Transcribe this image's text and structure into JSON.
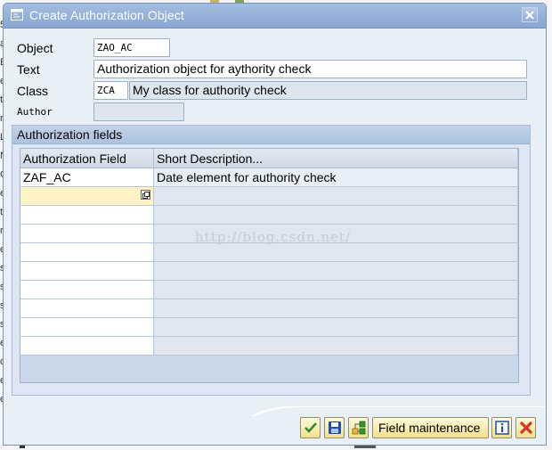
{
  "dialog": {
    "title": "Create Authorization Object",
    "close_icon": "close-icon"
  },
  "form": {
    "object_label": "Object",
    "object_value": "ZAO_AC",
    "text_label": "Text",
    "text_value": "Authorization object for aythority check",
    "class_label": "Class",
    "class_code": "ZCA",
    "class_description": "My class for authority check",
    "author_label": "Author",
    "author_value": ""
  },
  "fields_group": {
    "title": "Authorization fields",
    "columns": [
      "Authorization Field",
      "Short Description..."
    ],
    "rows": [
      [
        "ZAF_AC",
        "Date element for authority check"
      ],
      [
        "",
        ""
      ],
      [
        "",
        ""
      ],
      [
        "",
        ""
      ],
      [
        "",
        ""
      ],
      [
        "",
        ""
      ],
      [
        "",
        ""
      ],
      [
        "",
        ""
      ],
      [
        "",
        ""
      ],
      [
        "",
        ""
      ]
    ]
  },
  "watermark": "http://blog.csdn.net/",
  "toolbar": {
    "buttons": [
      {
        "icon": "check-icon",
        "color": "#2e8b2e"
      },
      {
        "icon": "save-icon",
        "color": "#1f4fa8"
      },
      {
        "icon": "hierarchy-icon",
        "color": "#2d9a2d"
      },
      {
        "label": "Field maintenance"
      },
      {
        "icon": "info-icon",
        "color": "#1f4fa8"
      },
      {
        "icon": "cancel-icon",
        "color": "#d8341f"
      }
    ]
  },
  "background": {
    "left_letters": [
      "5",
      "a",
      "E",
      "e",
      "t",
      "r",
      "L",
      "N",
      "G",
      "e",
      "t",
      "r",
      "e",
      "s",
      "s",
      "s",
      "s",
      "e",
      "o",
      "e",
      "e"
    ]
  }
}
